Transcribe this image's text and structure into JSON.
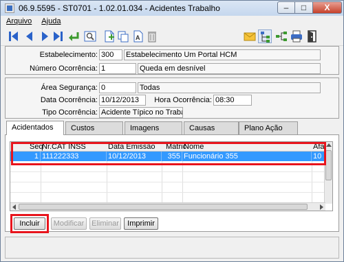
{
  "window": {
    "title": "06.9.5595 - ST0701 - 1.02.01.034 - Acidentes Trabalho",
    "buttons": {
      "minimize": "–",
      "maximize": "□",
      "close": "X"
    }
  },
  "menu": [
    {
      "label": "Arquivo"
    },
    {
      "label": "Ajuda"
    }
  ],
  "toolbar": {
    "icons": [
      "first-record-icon",
      "previous-record-icon",
      "next-record-icon",
      "last-record-icon",
      "confirm-icon",
      "search-icon",
      "new-record-icon",
      "copy-icon",
      "edit-icon",
      "delete-icon",
      "email-icon",
      "tree-icon",
      "hierarchy-icon",
      "print-icon",
      "exit-icon"
    ]
  },
  "header": {
    "estabelecimento_label": "Estabelecimento:",
    "estabelecimento_code": "300",
    "estabelecimento_name": "Estabelecimento Um Portal HCM",
    "numero_label": "Número Ocorrência:",
    "numero_code": "1",
    "numero_desc": "Queda em desnível"
  },
  "details": {
    "area_label": "Área Segurança:",
    "area_code": "0",
    "area_desc": "Todas",
    "data_label": "Data Ocorrência:",
    "data_value": "10/12/2013",
    "hora_label": "Hora Ocorrência:",
    "hora_value": "08:30",
    "tipo_label": "Tipo Ocorrência:",
    "tipo_value": "Acidente Típico no Trabalho"
  },
  "tabs": [
    {
      "label": "Acidentados",
      "active": true
    },
    {
      "label": "Custos"
    },
    {
      "label": "Imagens"
    },
    {
      "label": "Causas"
    },
    {
      "label": "Plano Ação"
    }
  ],
  "grid": {
    "columns": [
      "Seq",
      "Nr.CAT INSS",
      "Data Emissão",
      "Matric",
      "Nome",
      "Afa"
    ],
    "rows": [
      {
        "seq": "1",
        "cat": "111222333",
        "data": "10/12/2013",
        "matric": "355",
        "nome": "Funcionário 355",
        "afa": "10"
      }
    ]
  },
  "buttons": {
    "incluir": "Incluir",
    "modificar": "Modificar",
    "eliminar": "Eliminar",
    "imprimir": "Imprimir"
  },
  "colors": {
    "highlight": "#e8141c",
    "selected_row": "#3399ff"
  }
}
